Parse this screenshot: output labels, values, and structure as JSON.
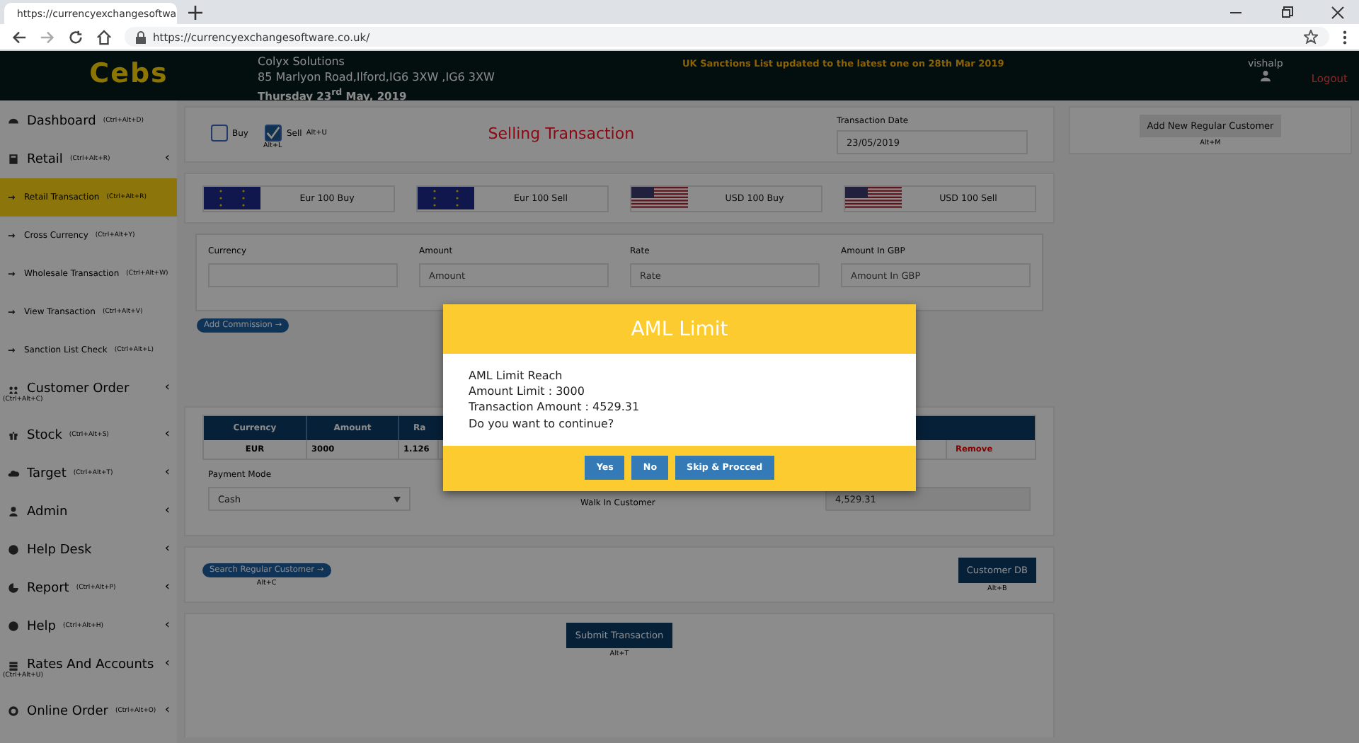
{
  "browser": {
    "tab_title": "https://currencyexchangesoftwa",
    "url": "https://currencyexchangesoftware.co.uk/"
  },
  "header": {
    "logo": "Cebs",
    "company": "Colyx Solutions",
    "address": "85 Marlyon Road,Ilford,IG6 3XW ,IG6 3XW",
    "date": "Thursday 23$^{rd}$ May, 2019",
    "notice": "UK Sanctions List updated to the latest one on 28th Mar 2019",
    "username": "vishalp",
    "logout": "Logout"
  },
  "sidebar": {
    "items": [
      {
        "kind": "section",
        "label": "Dashboard",
        "shortcut": "(Ctrl+Alt+D)",
        "selected": false
      },
      {
        "kind": "section",
        "label": "Retail",
        "shortcut": "(Ctrl+Alt+R)",
        "chevron": "‹",
        "selected": false
      },
      {
        "kind": "subitem",
        "label": "Retail Transaction",
        "shortcut": "(Ctrl+Alt+R)",
        "selected": true
      },
      {
        "kind": "subitem",
        "label": "Cross Currency",
        "shortcut": "(Ctrl+Alt+Y)",
        "selected": false
      },
      {
        "kind": "subitem",
        "label": "Wholesale Transaction",
        "shortcut": "(Ctrl+Alt+W)",
        "selected": false
      },
      {
        "kind": "subitem",
        "label": "View Transaction",
        "shortcut": "(Ctrl+Alt+V)",
        "selected": false
      },
      {
        "kind": "subitem",
        "label": "Sanction List Check",
        "shortcut": "(Ctrl+Alt+L)",
        "selected": false
      },
      {
        "kind": "wrapped",
        "label": "Customer Order",
        "shortcut": "(Ctrl+Alt+C)",
        "chevron": "‹",
        "selected": false
      },
      {
        "kind": "section",
        "label": "Stock",
        "shortcut": "(Ctrl+Alt+S)",
        "chevron": "‹",
        "selected": false
      },
      {
        "kind": "section",
        "label": "Target",
        "shortcut": "(Ctrl+Alt+T)",
        "chevron": "‹",
        "selected": false
      },
      {
        "kind": "section",
        "label": "Admin",
        "chevron": "‹",
        "selected": false
      },
      {
        "kind": "section",
        "label": "Help Desk",
        "chevron": "‹",
        "selected": false
      },
      {
        "kind": "section",
        "label": "Report",
        "shortcut": "(Ctrl+Alt+P)",
        "chevron": "‹",
        "selected": false
      },
      {
        "kind": "section",
        "label": "Help",
        "shortcut": "(Ctrl+Alt+H)",
        "chevron": "‹",
        "selected": false
      },
      {
        "kind": "wrapped",
        "label": "Rates And Accounts",
        "shortcut": "(Ctrl+Alt+U)",
        "chevron": "‹",
        "selected": false
      },
      {
        "kind": "section",
        "label": "Online Order",
        "shortcut": "(Ctrl+Alt+O)",
        "chevron": "‹",
        "selected": false
      }
    ]
  },
  "transaction": {
    "options": [
      {
        "label": "Buy",
        "checked": false
      },
      {
        "label": "Sell",
        "shortcut": "Alt+U",
        "checked": true
      }
    ],
    "sub_shortcut": "Alt+L",
    "title": "Selling Transaction",
    "date_label": "Transaction Date",
    "date": "23/05/2019"
  },
  "quick_buttons": [
    {
      "label": "Eur 100 Buy"
    },
    {
      "label": "Eur 100 Sell"
    },
    {
      "label": "USD 100 Buy"
    },
    {
      "label": "USD 100 Sell"
    }
  ],
  "fields": [
    {
      "label": "Currency"
    },
    {
      "label": "Amount",
      "placeholder": "Amount"
    },
    {
      "label": "Rate",
      "placeholder": "Rate"
    },
    {
      "label": "Amount In GBP",
      "placeholder": "Amount In GBP"
    }
  ],
  "add_commission": "Add Commission →",
  "table": {
    "columns": [
      "Currency",
      "Amount",
      "Ra"
    ],
    "rows": [
      {
        "cells": [
          "EUR",
          "3000",
          "1.126"
        ],
        "action": "Remove"
      }
    ]
  },
  "payment": {
    "label": "Payment Mode",
    "value": "Cash",
    "walk_in": "Walk In Customer",
    "total": "4,529.31"
  },
  "search_customer": {
    "label": "Search Regular Customer →",
    "shortcut": "Alt+C"
  },
  "customer_db": {
    "label": "Customer DB",
    "shortcut": "Alt+B"
  },
  "submit": {
    "label": "Submit Transaction",
    "shortcut": "Alt+T"
  },
  "add_customer": {
    "label": "Add New Regular Customer",
    "shortcut": "Alt+M"
  },
  "modal": {
    "title": "AML Limit",
    "lines": [
      "AML Limit Reach",
      "Amount Limit : 3000",
      "Transaction Amount : 4529.31",
      "Do you want to continue?"
    ],
    "buttons": [
      "Yes",
      "No",
      "Skip & Procced"
    ]
  }
}
